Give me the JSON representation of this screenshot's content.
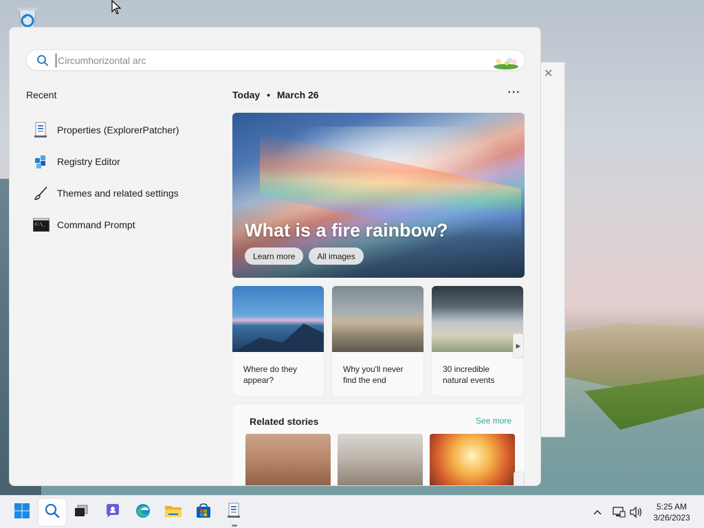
{
  "search": {
    "placeholder": "Circumhorizontal arc"
  },
  "recent": {
    "title": "Recent",
    "items": [
      {
        "label": "Properties (ExplorerPatcher)",
        "icon": "properties-icon"
      },
      {
        "label": "Registry Editor",
        "icon": "registry-editor-icon"
      },
      {
        "label": "Themes and related settings",
        "icon": "brush-icon"
      },
      {
        "label": "Command Prompt",
        "icon": "command-prompt-icon"
      }
    ]
  },
  "highlights": {
    "day": "Today",
    "separator": "•",
    "date": "March 26",
    "more": "···",
    "hero": {
      "title": "What is a fire rainbow?",
      "learn_more": "Learn more",
      "all_images": "All images"
    },
    "cards": [
      {
        "caption": "Where do they appear?"
      },
      {
        "caption": "Why you'll never find the end"
      },
      {
        "caption": "30 incredible natural events"
      }
    ],
    "related": {
      "title": "Related stories",
      "see_more": "See more"
    }
  },
  "taskbar": {
    "apps": [
      "start-icon",
      "search-icon",
      "task-view-icon",
      "chat-icon",
      "edge-icon",
      "file-explorer-icon",
      "store-icon",
      "properties-app-icon"
    ],
    "tray": [
      "chevron-up-icon",
      "network-icon",
      "volume-icon"
    ],
    "time": "5:25 AM",
    "date": "3/26/2023"
  },
  "colors": {
    "accent": "#0067c0",
    "see_more": "#2aa89a"
  }
}
